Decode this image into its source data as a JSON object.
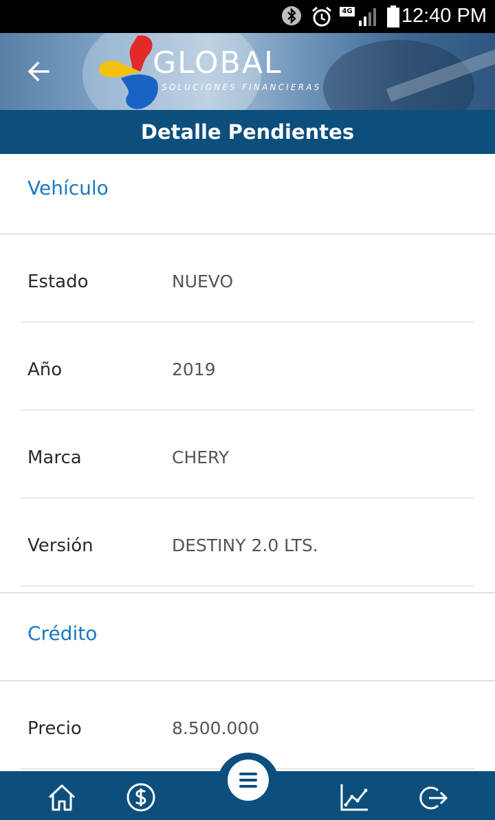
{
  "status_bar": {
    "time": "12:40 PM",
    "network_label": "4G",
    "icons": [
      "bluetooth-icon",
      "alarm-icon",
      "network-4g-icon",
      "signal-icon",
      "battery-icon"
    ]
  },
  "header": {
    "back_icon": "arrow-left-icon",
    "logo_word": "GLOBAL",
    "logo_subtitle": "SOLUCIONES FINANCIERAS"
  },
  "title_bar": {
    "title": "Detalle Pendientes"
  },
  "sections": {
    "vehiculo": {
      "title": "Vehículo",
      "rows": [
        {
          "label": "Estado",
          "value": "NUEVO"
        },
        {
          "label": "Año",
          "value": "2019"
        },
        {
          "label": "Marca",
          "value": "CHERY"
        },
        {
          "label": "Versión",
          "value": "DESTINY 2.0 LTS."
        }
      ]
    },
    "credito": {
      "title": "Crédito",
      "rows": [
        {
          "label": "Precio",
          "value": "8.500.000"
        }
      ]
    }
  },
  "bottom_nav": {
    "items": [
      "home-icon",
      "dollar-icon",
      "menu-icon",
      "chart-icon",
      "logout-icon"
    ]
  },
  "colors": {
    "primary": "#0c4f7c",
    "section_title": "#1a78c2",
    "label": "#2a2a2a",
    "value": "#555555"
  }
}
